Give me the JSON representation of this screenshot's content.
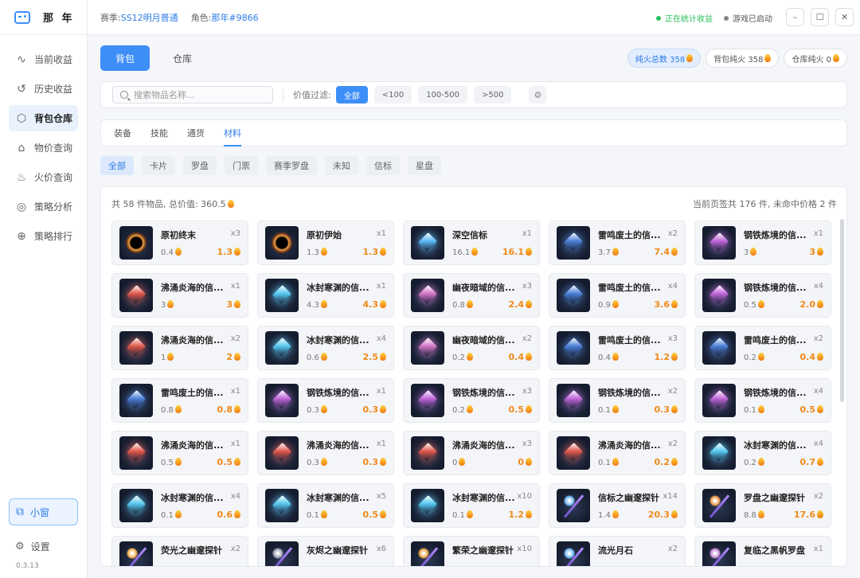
{
  "app": {
    "name": "那 年",
    "version": "0.3.13"
  },
  "sidebar": {
    "items": [
      {
        "label": "当前收益",
        "icon": "pulse-icon",
        "glyph": "∿",
        "active": false
      },
      {
        "label": "历史收益",
        "icon": "history-icon",
        "glyph": "↺",
        "active": false
      },
      {
        "label": "背包仓库",
        "icon": "cube-icon",
        "glyph": "⬡",
        "active": true
      },
      {
        "label": "物价查询",
        "icon": "tag-icon",
        "glyph": "⌂",
        "active": false
      },
      {
        "label": "火价查询",
        "icon": "flame-icon",
        "glyph": "♨",
        "active": false
      },
      {
        "label": "策略分析",
        "icon": "compass-icon",
        "glyph": "◎",
        "active": false
      },
      {
        "label": "策略排行",
        "icon": "globe-icon",
        "glyph": "⊕",
        "active": false
      }
    ],
    "mini_window": "小窗",
    "settings": "设置"
  },
  "header": {
    "season_label": "赛季:",
    "season_value": "SS12明月普通",
    "role_label": "角色:",
    "role_value": "那年#9866",
    "status_stats": "正在统计收益",
    "status_game": "游戏已启动",
    "status_colors": {
      "stats": "#2bbf5a",
      "game": "#888888"
    }
  },
  "tabs": {
    "backpack": "背包",
    "warehouse": "仓库"
  },
  "fire_totals": {
    "total": "纯火总数 358",
    "backpack": "背包纯火 358",
    "warehouse": "仓库纯火 0"
  },
  "filter": {
    "search_placeholder": "搜索物品名称...",
    "value_label": "价值过滤:",
    "options": [
      "全部",
      "<100",
      "100-500",
      ">500"
    ]
  },
  "subtabs": [
    "装备",
    "技能",
    "通货",
    "材料"
  ],
  "categories": [
    "全部",
    "卡片",
    "罗盘",
    "门票",
    "赛季罗盘",
    "未知",
    "信标",
    "星盘"
  ],
  "summary": {
    "left": "共 58 件物品, 总价值: 360.5",
    "right": "当前页签共 176 件, 未命中价格 2 件"
  },
  "items": [
    {
      "name": "原初终末",
      "qty": "x3",
      "unit": "0.4",
      "total": "1.3",
      "art": "vortex",
      "color": "#f0a040"
    },
    {
      "name": "原初伊始",
      "qty": "x1",
      "unit": "1.3",
      "total": "1.3",
      "art": "vortex",
      "color": "#f0a040"
    },
    {
      "name": "深空信标",
      "qty": "x1",
      "unit": "16.1",
      "total": "16.1",
      "art": "gem",
      "color": "#5ab8f5"
    },
    {
      "name": "雷鸣废土的信...",
      "qty": "x2",
      "unit": "3.7",
      "total": "7.4",
      "art": "gem",
      "color": "#4a7fd6"
    },
    {
      "name": "钢铁炼境的信...",
      "qty": "x1",
      "unit": "3",
      "total": "3",
      "art": "gem",
      "color": "#c065d8"
    },
    {
      "name": "沸涌炎海的信...",
      "qty": "x1",
      "unit": "3",
      "total": "3",
      "art": "gem",
      "color": "#e0584a"
    },
    {
      "name": "冰封寒渊的信...",
      "qty": "x1",
      "unit": "4.3",
      "total": "4.3",
      "art": "gem",
      "color": "#55c8f0"
    },
    {
      "name": "幽夜暗域的信...",
      "qty": "x3",
      "unit": "0.8",
      "total": "2.4",
      "art": "gem",
      "color": "#d576c8"
    },
    {
      "name": "雷鸣废土的信...",
      "qty": "x4",
      "unit": "0.9",
      "total": "3.6",
      "art": "gem",
      "color": "#4a7fd6"
    },
    {
      "name": "钢铁炼境的信...",
      "qty": "x4",
      "unit": "0.5",
      "total": "2.0",
      "art": "gem",
      "color": "#c065d8"
    },
    {
      "name": "沸涌炎海的信...",
      "qty": "x2",
      "unit": "1",
      "total": "2",
      "art": "gem",
      "color": "#e0584a"
    },
    {
      "name": "冰封寒渊的信...",
      "qty": "x4",
      "unit": "0.6",
      "total": "2.5",
      "art": "gem",
      "color": "#55c8f0"
    },
    {
      "name": "幽夜暗域的信...",
      "qty": "x2",
      "unit": "0.2",
      "total": "0.4",
      "art": "gem",
      "color": "#d576c8"
    },
    {
      "name": "雷鸣废土的信...",
      "qty": "x3",
      "unit": "0.4",
      "total": "1.2",
      "art": "gem",
      "color": "#4a7fd6"
    },
    {
      "name": "雷鸣废土的信...",
      "qty": "x2",
      "unit": "0.2",
      "total": "0.4",
      "art": "gem",
      "color": "#4a7fd6"
    },
    {
      "name": "雷鸣废土的信...",
      "qty": "x1",
      "unit": "0.8",
      "total": "0.8",
      "art": "gem",
      "color": "#4a7fd6"
    },
    {
      "name": "钢铁炼境的信...",
      "qty": "x1",
      "unit": "0.3",
      "total": "0.3",
      "art": "gem",
      "color": "#c065d8"
    },
    {
      "name": "钢铁炼境的信...",
      "qty": "x3",
      "unit": "0.2",
      "total": "0.5",
      "art": "gem",
      "color": "#c065d8"
    },
    {
      "name": "钢铁炼境的信...",
      "qty": "x2",
      "unit": "0.1",
      "total": "0.3",
      "art": "gem",
      "color": "#c065d8"
    },
    {
      "name": "钢铁炼境的信...",
      "qty": "x4",
      "unit": "0.1",
      "total": "0.5",
      "art": "gem",
      "color": "#c065d8"
    },
    {
      "name": "沸涌炎海的信...",
      "qty": "x1",
      "unit": "0.5",
      "total": "0.5",
      "art": "gem",
      "color": "#e0584a"
    },
    {
      "name": "沸涌炎海的信...",
      "qty": "x1",
      "unit": "0.3",
      "total": "0.3",
      "art": "gem",
      "color": "#e0584a"
    },
    {
      "name": "沸涌炎海的信...",
      "qty": "x3",
      "unit": "0",
      "total": "0",
      "art": "gem",
      "color": "#e0584a"
    },
    {
      "name": "沸涌炎海的信...",
      "qty": "x2",
      "unit": "0.1",
      "total": "0.2",
      "art": "gem",
      "color": "#e0584a"
    },
    {
      "name": "冰封寒渊的信...",
      "qty": "x4",
      "unit": "0.2",
      "total": "0.7",
      "art": "gem",
      "color": "#55c8f0"
    },
    {
      "name": "冰封寒渊的信...",
      "qty": "x4",
      "unit": "0.1",
      "total": "0.6",
      "art": "gem",
      "color": "#55c8f0"
    },
    {
      "name": "冰封寒渊的信...",
      "qty": "x5",
      "unit": "0.1",
      "total": "0.5",
      "art": "gem",
      "color": "#55c8f0"
    },
    {
      "name": "冰封寒渊的信...",
      "qty": "x10",
      "unit": "0.1",
      "total": "1.2",
      "art": "gem",
      "color": "#55c8f0"
    },
    {
      "name": "信标之幽邃探针",
      "qty": "x14",
      "unit": "1.4",
      "total": "20.3",
      "art": "staff",
      "color": "#6fb6f5"
    },
    {
      "name": "罗盘之幽邃探针",
      "qty": "x2",
      "unit": "8.8",
      "total": "17.6",
      "art": "staff",
      "color": "#e89a4a"
    },
    {
      "name": "荧光之幽邃探针",
      "qty": "x2",
      "unit": "",
      "total": "",
      "art": "staff",
      "color": "#f0b050"
    },
    {
      "name": "灰烬之幽邃探针",
      "qty": "x6",
      "unit": "",
      "total": "",
      "art": "staff",
      "color": "#9aa0b0"
    },
    {
      "name": "繁荣之幽邃探针",
      "qty": "x10",
      "unit": "",
      "total": "",
      "art": "staff",
      "color": "#e8a040"
    },
    {
      "name": "流光月石",
      "qty": "x2",
      "unit": "",
      "total": "",
      "art": "staff",
      "color": "#6fb6f5"
    },
    {
      "name": "复临之黑帆罗盘",
      "qty": "x1",
      "unit": "",
      "total": "",
      "art": "staff",
      "color": "#c58ad8"
    }
  ]
}
